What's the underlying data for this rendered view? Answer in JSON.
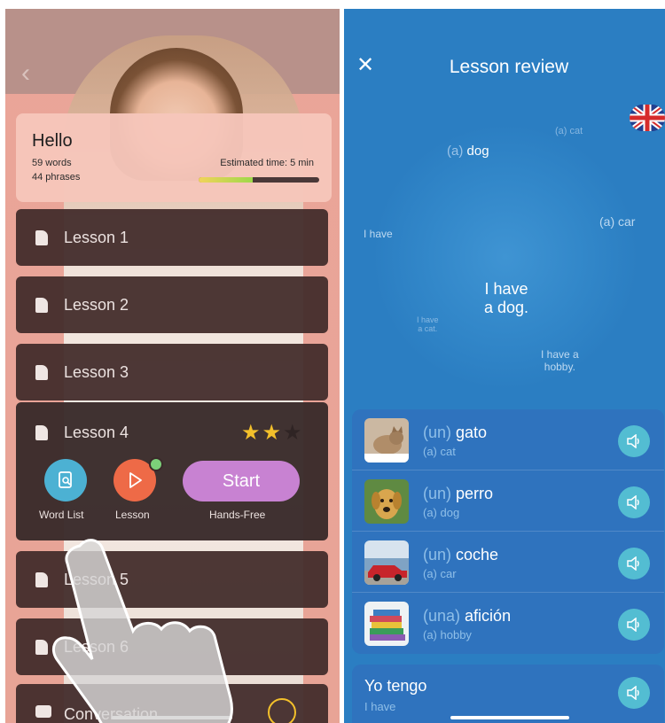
{
  "left": {
    "back_icon": "chevron-left-icon",
    "header": {
      "title": "Hello",
      "words": "59 words",
      "phrases": "44 phrases",
      "estimated_time": "Estimated time: 5 min",
      "progress_fraction": 0.45
    },
    "lessons": [
      {
        "label": "Lesson 1"
      },
      {
        "label": "Lesson 2"
      },
      {
        "label": "Lesson 3"
      },
      {
        "label": "Lesson 4"
      },
      {
        "label": "Lesson 5"
      },
      {
        "label": "Lesson 6"
      }
    ],
    "expanded_lesson": {
      "stars_earned": 2,
      "stars_total": 3,
      "word_list_label": "Word List",
      "lesson_label": "Lesson",
      "start_label": "Start",
      "hands_free_label": "Hands-Free"
    },
    "conversation": {
      "label": "Conversation"
    }
  },
  "right": {
    "title": "Lesson review",
    "close_icon": "close-icon",
    "flag_icon": "uk-flag-icon",
    "word_cloud": {
      "cat": "(a) cat",
      "dog_article": "(a)",
      "dog_word": "dog",
      "i_have": "I have",
      "car": "(a) car",
      "main_line1": "I have",
      "main_line2": "a dog.",
      "have_cat_line1": "I have",
      "have_cat_line2": "a cat.",
      "hobby_line1": "I have a",
      "hobby_line2": "hobby."
    },
    "vocab": [
      {
        "article": "(un)",
        "word": "gato",
        "translation": "(a) cat",
        "image": "cat-photo"
      },
      {
        "article": "(un)",
        "word": "perro",
        "translation": "(a) dog",
        "image": "dog-photo"
      },
      {
        "article": "(un)",
        "word": "coche",
        "translation": "(a) car",
        "image": "car-photo"
      },
      {
        "article": "(una)",
        "word": "afición",
        "translation": "(a) hobby",
        "image": "hobby-photo"
      }
    ],
    "phrase": {
      "text": "Yo tengo",
      "translation": "I have"
    }
  }
}
